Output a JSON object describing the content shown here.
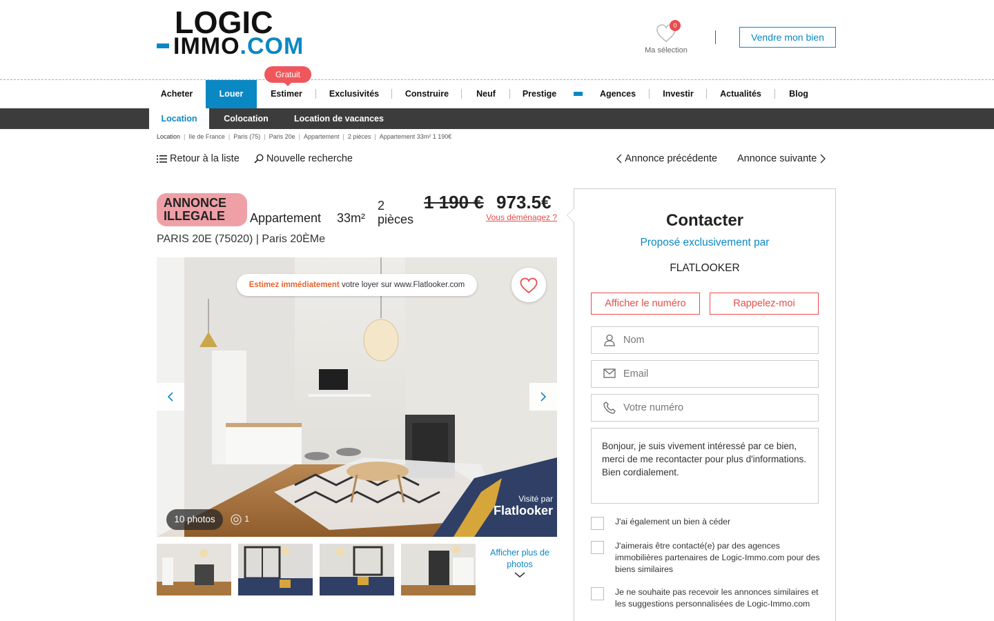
{
  "brand": {
    "logo_top": "LOGIC",
    "logo_bottom": "IMMO",
    "logo_com": ".COM",
    "accent": "#0a88c4",
    "alert": "#e84c4c"
  },
  "header": {
    "selection_label": "Ma sélection",
    "selection_count": "0",
    "sell_button": "Vendre mon bien"
  },
  "nav": {
    "badge": "Gratuit",
    "items": [
      "Acheter",
      "Louer",
      "Estimer",
      "Exclusivités",
      "Construire",
      "Neuf",
      "Prestige",
      "Agences",
      "Investir",
      "Actualités",
      "Blog"
    ],
    "active": "Louer"
  },
  "subnav": {
    "items": [
      "Location",
      "Colocation",
      "Location de vacances"
    ],
    "active": "Location"
  },
  "breadcrumb": [
    "Location",
    "Ile de France",
    "Paris (75)",
    "Paris 20e",
    "Appartement",
    "2 pièces",
    "Appartement 33m² 1 190€"
  ],
  "toolbar": {
    "back": "Retour à la liste",
    "search": "Nouvelle recherche",
    "prev": "Annonce précédente",
    "next": "Annonce suivante"
  },
  "listing": {
    "flag": "ANNONCE ILLEGALE",
    "type": "Appartement",
    "surface": "33m²",
    "rooms_num": "2",
    "rooms_label": "pièces",
    "old_price": "1 190 €",
    "new_price": "973.5€",
    "moving_link": "Vous déménagez ?",
    "location": "PARIS 20E (75020) | Paris 20ÈMe"
  },
  "photo": {
    "banner_highlight": "Estimez immédiatement",
    "banner_rest": "votre loyer sur www.Flatlooker.com",
    "count": "10 photos",
    "visits": "1",
    "visited_by": "Visité par",
    "visited_brand": "Flatlooker",
    "more_photos": "Afficher plus de photos"
  },
  "contact": {
    "title": "Contacter",
    "subtitle": "Proposé exclusivement par",
    "agency": "FLATLOOKER",
    "show_number": "Afficher le numéro",
    "call_me": "Rappelez-moi",
    "name_placeholder": "Nom",
    "email_placeholder": "Email",
    "phone_placeholder": "Votre numéro",
    "message": "Bonjour, je suis vivement intéressé par ce bien, merci de me recontacter pour plus d'informations. Bien cordialement.",
    "checkboxes": [
      "J'ai également un bien à céder",
      "J'aimerais être contacté(e) par des agences immobilières partenaires de Logic-Immo.com pour des biens similaires",
      "Je ne souhaite pas recevoir les annonces similaires et les suggestions personnalisées de Logic-Immo.com"
    ]
  }
}
